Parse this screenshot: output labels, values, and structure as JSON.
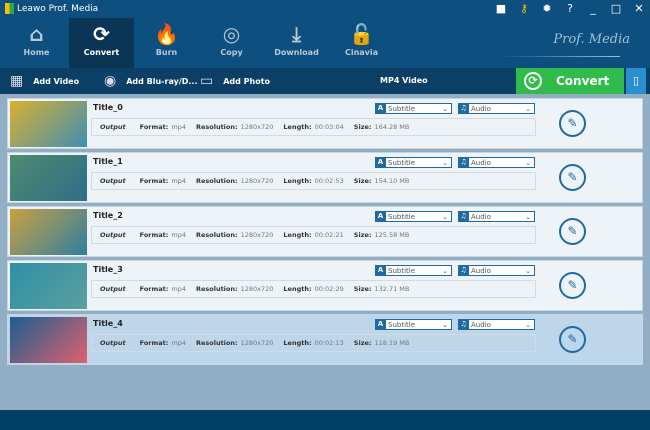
{
  "app": {
    "title": "Leawo Prof. Media",
    "brand": "Prof. Media"
  },
  "window_controls": [
    {
      "icon": "chat-icon",
      "glyph": "■"
    },
    {
      "icon": "key-icon",
      "glyph": "⚷"
    },
    {
      "icon": "gear-icon",
      "glyph": "✹"
    },
    {
      "icon": "help-icon",
      "glyph": "?"
    },
    {
      "icon": "minimize-icon",
      "glyph": "_"
    },
    {
      "icon": "maximize-icon",
      "glyph": "□"
    },
    {
      "icon": "close-icon",
      "glyph": "✕"
    }
  ],
  "nav": [
    {
      "label": "Home",
      "icon": "home-icon",
      "glyph": "⌂"
    },
    {
      "label": "Convert",
      "icon": "convert-icon",
      "glyph": "⟳",
      "active": true
    },
    {
      "label": "Burn",
      "icon": "burn-icon",
      "glyph": "🔥"
    },
    {
      "label": "Copy",
      "icon": "copy-icon",
      "glyph": "◎"
    },
    {
      "label": "Download",
      "icon": "download-icon",
      "glyph": "⤓"
    },
    {
      "label": "Cinavia",
      "icon": "cinavia-icon",
      "glyph": "🔓"
    }
  ],
  "toolbar": {
    "add_video": "Add Video",
    "add_bluray": "Add Blu-ray/D...",
    "add_photo": "Add Photo",
    "profile": "MP4 Video",
    "convert": "Convert"
  },
  "labels": {
    "output": "Output",
    "format": "Format:",
    "resolution": "Resolution:",
    "length": "Length:",
    "size": "Size:",
    "subtitle": "Subtitle",
    "audio": "Audio"
  },
  "titles": [
    {
      "title": "Title_0",
      "format": "mp4",
      "resolution": "1280x720",
      "length": "00:03:04",
      "size": "164.28 MB",
      "colors": [
        "#d9b030",
        "#3f8fb0"
      ]
    },
    {
      "title": "Title_1",
      "format": "mp4",
      "resolution": "1280x720",
      "length": "00:02:53",
      "size": "154.10 MB",
      "colors": [
        "#4f8a70",
        "#2d6e88"
      ]
    },
    {
      "title": "Title_2",
      "format": "mp4",
      "resolution": "1280x720",
      "length": "00:02:21",
      "size": "125.58 MB",
      "colors": [
        "#c8a040",
        "#2f7fa0"
      ]
    },
    {
      "title": "Title_3",
      "format": "mp4",
      "resolution": "1280x720",
      "length": "00:02:29",
      "size": "132.71 MB",
      "colors": [
        "#2f8fa5",
        "#5aa0a0"
      ]
    },
    {
      "title": "Title_4",
      "format": "mp4",
      "resolution": "1280x720",
      "length": "00:02:13",
      "size": "118.19 MB",
      "colors": [
        "#1a5f90",
        "#e06070"
      ],
      "selected": true
    }
  ],
  "colors": {
    "accent": "#0d4f7f",
    "convert": "#2fbc4a",
    "selected_row": "#bdd6ea"
  }
}
